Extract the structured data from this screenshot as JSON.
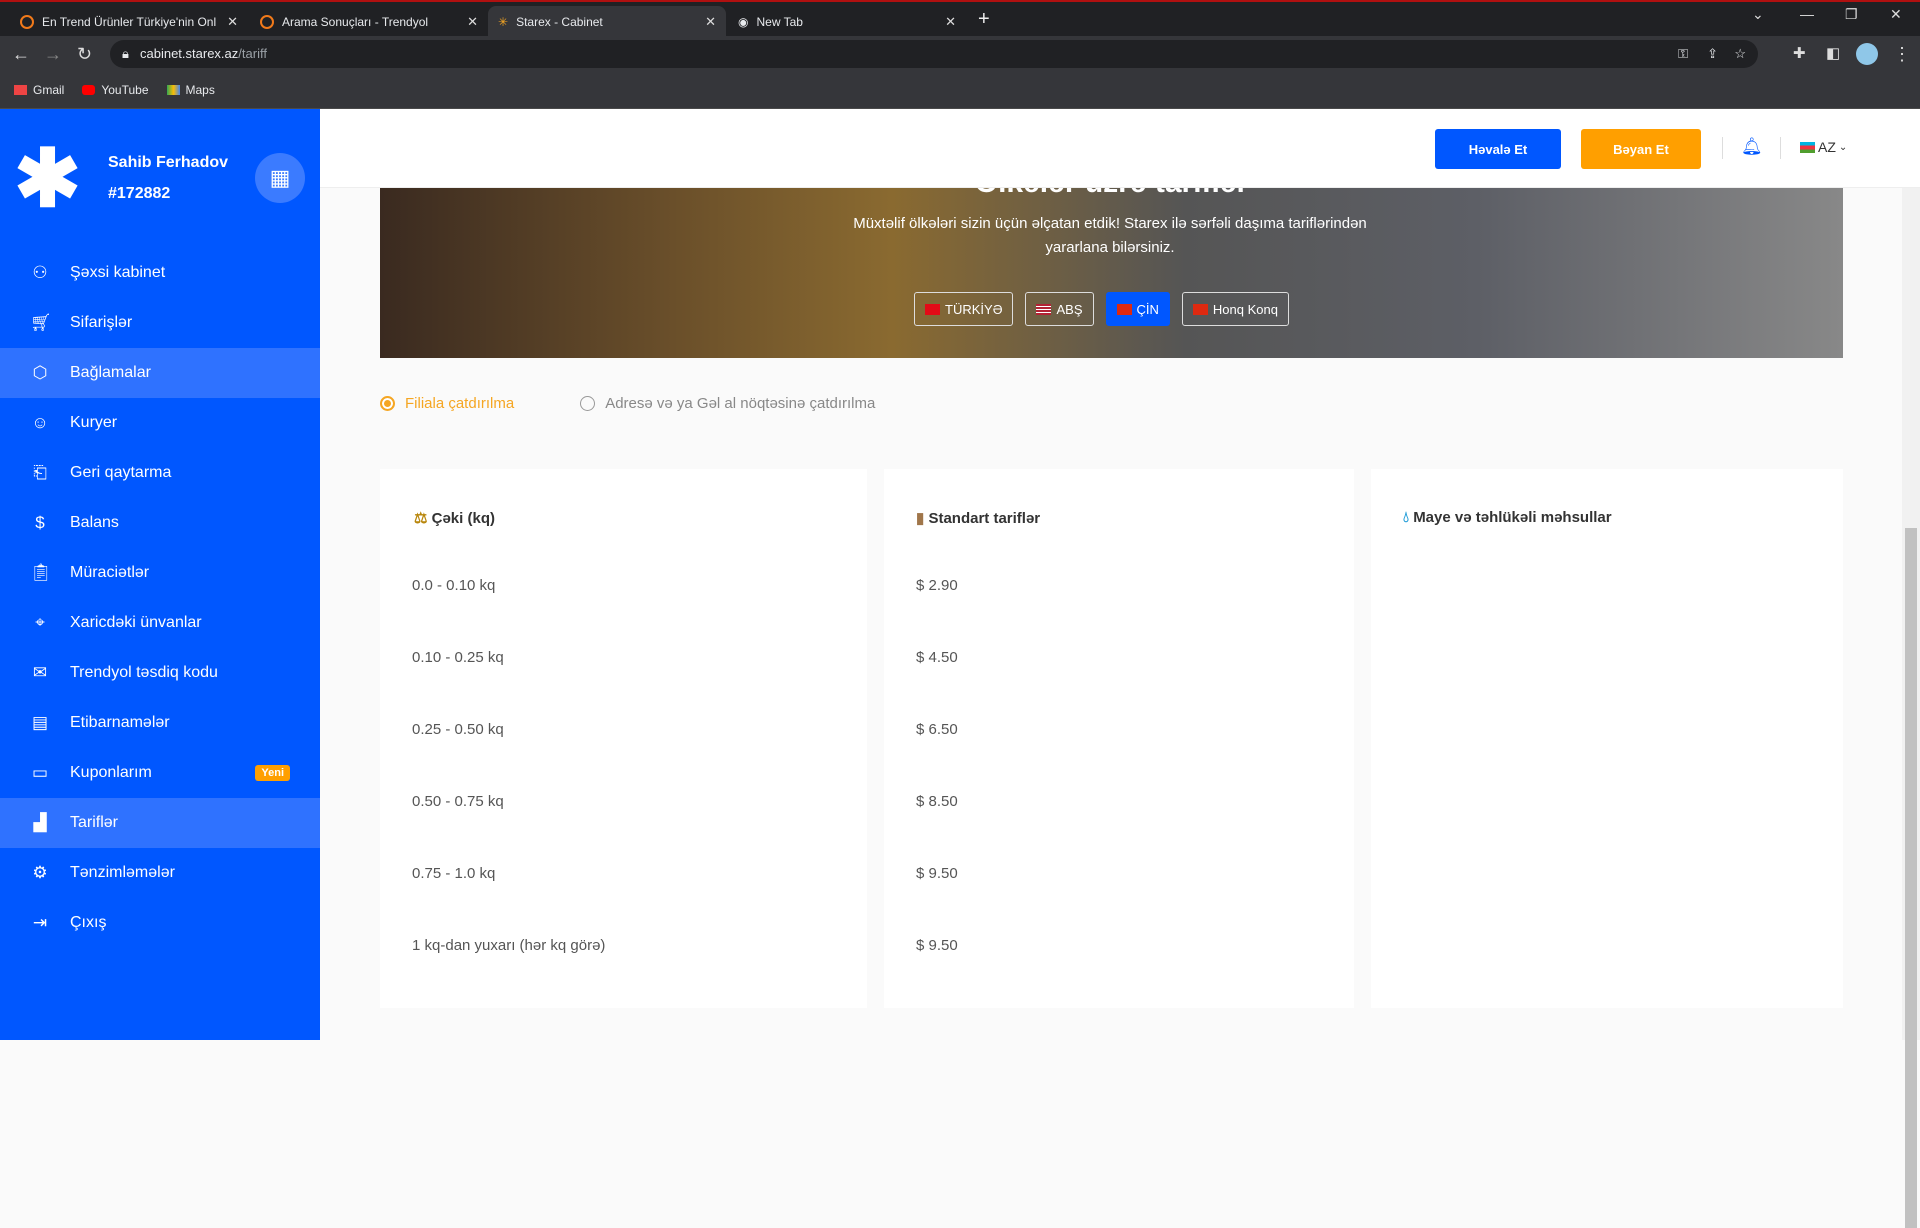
{
  "browser": {
    "tabs": [
      {
        "title": "En Trend Ürünler Türkiye'nin Onl"
      },
      {
        "title": "Arama Sonuçları - Trendyol"
      },
      {
        "title": "Starex - Cabinet"
      },
      {
        "title": "New Tab"
      }
    ],
    "url_host": "cabinet.starex.az",
    "url_path": "/tariff",
    "bookmarks": [
      "Gmail",
      "YouTube",
      "Maps"
    ]
  },
  "user": {
    "name": "Sahib Ferhadov",
    "id": "#172882"
  },
  "sidebar": {
    "items": [
      {
        "label": "Şəxsi kabinet",
        "icon": "user-icon"
      },
      {
        "label": "Sifarişlər",
        "icon": "cart-icon"
      },
      {
        "label": "Bağlamalar",
        "icon": "box-icon"
      },
      {
        "label": "Kuryer",
        "icon": "courier-icon"
      },
      {
        "label": "Geri qaytarma",
        "icon": "return-icon"
      },
      {
        "label": "Balans",
        "icon": "dollar-icon"
      },
      {
        "label": "Müraciətlər",
        "icon": "clipboard-icon"
      },
      {
        "label": "Xaricdəki ünvanlar",
        "icon": "location-icon"
      },
      {
        "label": "Trendyol təsdiq kodu",
        "icon": "mail-icon"
      },
      {
        "label": "Etibarnamələr",
        "icon": "document-icon"
      },
      {
        "label": "Kuponlarım",
        "icon": "coupon-icon",
        "badge": "Yeni"
      },
      {
        "label": "Tariflər",
        "icon": "chart-icon"
      },
      {
        "label": "Tənzimləmələr",
        "icon": "gear-icon"
      },
      {
        "label": "Çıxış",
        "icon": "logout-icon"
      }
    ]
  },
  "header": {
    "havale": "Həvalə Et",
    "beyan": "Bəyan Et",
    "lang": "AZ",
    "colors": {
      "blue": "#0057ff",
      "orange": "#ff9f00"
    }
  },
  "banner": {
    "title": "Ölkələr üzrə tariflər",
    "subtitle": "Müxtəlif ölkələri sizin üçün əlçatan etdik! Starex ilə sərfəli daşıma tariflərindən yararlana bilərsiniz.",
    "countries": [
      "TÜRKİYƏ",
      "ABŞ",
      "ÇİN",
      "Honq Konq"
    ],
    "active_country": "ÇİN"
  },
  "delivery": {
    "options": [
      "Filiala çatdırılma",
      "Adresə və ya Gəl al nöqtəsinə çatdırılma"
    ],
    "selected": "Filiala çatdırılma"
  },
  "tariffs": {
    "weight_title": "Çəki (kq)",
    "standard_title": "Standart tariflər",
    "liquid_title": "Maye və təhlükəli məhsullar",
    "weights": [
      "0.0 - 0.10 kq",
      "0.10 - 0.25 kq",
      "0.25 - 0.50 kq",
      "0.50 - 0.75 kq",
      "0.75 - 1.0 kq",
      "1 kq-dan yuxarı (hər kq görə)"
    ],
    "prices": [
      "$ 2.90",
      "$ 4.50",
      "$ 6.50",
      "$ 8.50",
      "$ 9.50",
      "$ 9.50"
    ]
  }
}
